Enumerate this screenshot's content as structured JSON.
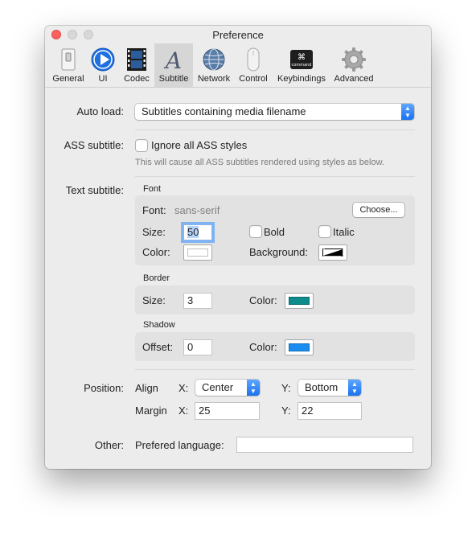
{
  "window": {
    "title": "Preference"
  },
  "toolbar": {
    "items": [
      {
        "label": "General",
        "icon": "switch-icon"
      },
      {
        "label": "UI",
        "icon": "play-icon"
      },
      {
        "label": "Codec",
        "icon": "film-icon"
      },
      {
        "label": "Subtitle",
        "icon": "letter-a-icon",
        "active": true
      },
      {
        "label": "Network",
        "icon": "globe-icon"
      },
      {
        "label": "Control",
        "icon": "mouse-icon"
      },
      {
        "label": "Keybindings",
        "icon": "command-key-icon"
      },
      {
        "label": "Advanced",
        "icon": "gear-icon"
      }
    ],
    "command_key_text": "command"
  },
  "auto_load": {
    "label": "Auto load:",
    "value": "Subtitles containing media filename"
  },
  "ass": {
    "label": "ASS subtitle:",
    "checkbox_label": "Ignore all ASS styles",
    "checked": false,
    "hint": "This will cause all ASS subtitles rendered using styles as below."
  },
  "text_subtitle": {
    "label": "Text subtitle:",
    "font_section": {
      "title": "Font",
      "font_label": "Font:",
      "font_value": "sans-serif",
      "choose_label": "Choose...",
      "size_label": "Size:",
      "size_value": "50",
      "bold_label": "Bold",
      "italic_label": "Italic",
      "color_label": "Color:",
      "color": "#ffffff",
      "background_label": "Background:",
      "background_color": "#000000"
    },
    "border_section": {
      "title": "Border",
      "size_label": "Size:",
      "size_value": "3",
      "color_label": "Color:",
      "color": "#0e8c8c"
    },
    "shadow_section": {
      "title": "Shadow",
      "offset_label": "Offset:",
      "offset_value": "0",
      "color_label": "Color:",
      "color": "#1a8ef0"
    }
  },
  "position": {
    "label": "Position:",
    "align_label": "Align",
    "x_label": "X:",
    "y_label": "Y:",
    "align_x": "Center",
    "align_y": "Bottom",
    "margin_label": "Margin",
    "margin_x": "25",
    "margin_y": "22"
  },
  "other": {
    "label": "Other:",
    "preferred_language_label": "Prefered language:",
    "preferred_language_value": ""
  }
}
